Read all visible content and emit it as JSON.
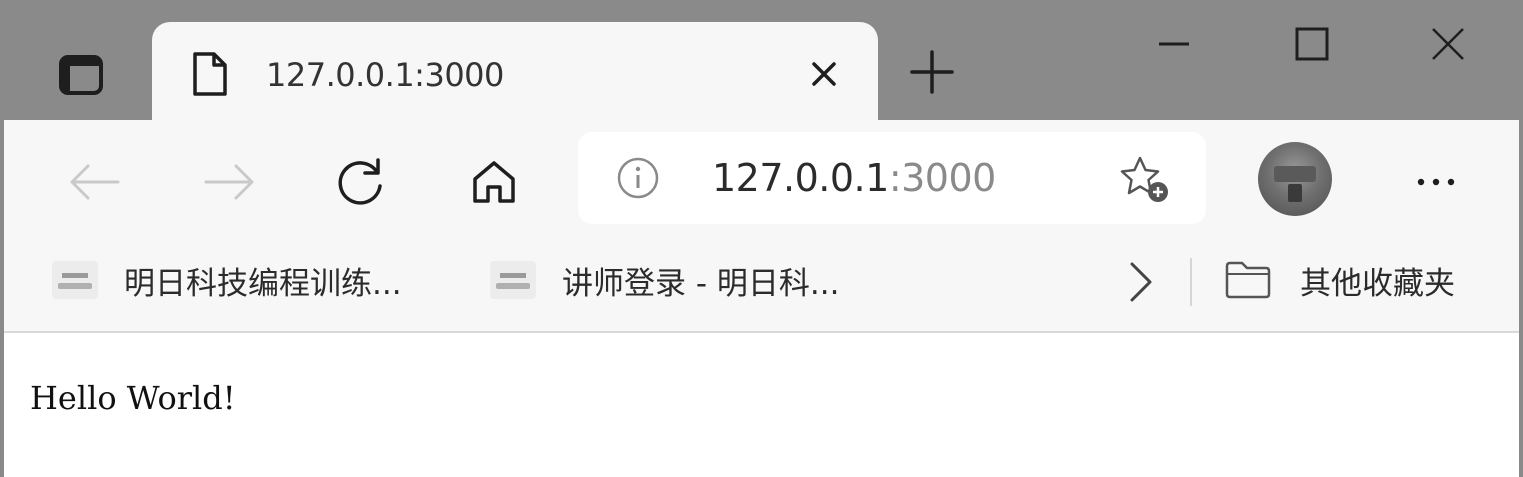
{
  "tab": {
    "title": "127.0.0.1:3000",
    "icon": "page-icon",
    "close_icon": "close-icon"
  },
  "new_tab_icon": "plus-icon",
  "window_controls": [
    "minimize-icon",
    "maximize-icon",
    "close-icon"
  ],
  "toolbar": {
    "back_icon": "arrow-left-icon",
    "forward_icon": "arrow-right-icon",
    "refresh_icon": "refresh-icon",
    "home_icon": "home-icon",
    "more_label": "···"
  },
  "address_bar": {
    "host": "127.0.0.1",
    "port": ":3000",
    "info_icon": "info-icon",
    "favorite_icon": "star-add-icon"
  },
  "bookmarks": {
    "items": [
      {
        "label": "明日科技编程训练..."
      },
      {
        "label": "讲师登录 - 明日科..."
      }
    ],
    "other_label": "其他收藏夹"
  },
  "page": {
    "text": "Hello World!"
  },
  "colors": {
    "titlebar": "#8a8a8a",
    "toolbar": "#f7f7f7",
    "content": "#ffffff"
  }
}
